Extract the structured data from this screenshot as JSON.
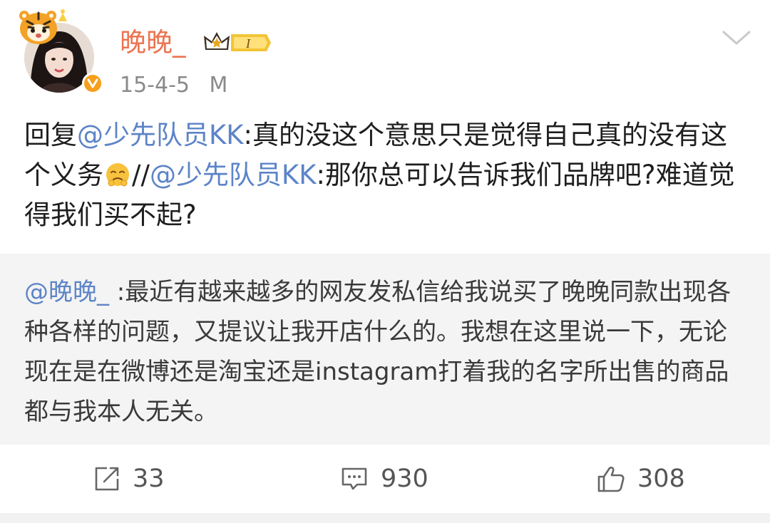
{
  "post": {
    "username": "晚晚_",
    "vip_level": "I",
    "date": "15-4-5",
    "source": "M",
    "content": {
      "prefix": "回复",
      "mention_1": "@少先队员KK",
      "text_1": ":真的没这个意思只是觉得自己真的没有这个义务",
      "emoji": "wronged-face-emoji",
      "separator": "//",
      "mention_2": "@少先队员KK",
      "text_2": ":那你总可以告诉我们品牌吧?难道觉得我们买不起?"
    },
    "retweet": {
      "mention": "@晚晚_",
      "text": " :最近有越来越多的网友发私信给我说买了晚晚同款出现各种各样的问题，又提议让我开店什么的。我想在这里说一下，无论现在是在微博还是淘宝还是instagram打着我的名字所出售的商品都与我本人无关。"
    },
    "actions": {
      "repost_count": "33",
      "comment_count": "930",
      "like_count": "308"
    },
    "colors": {
      "username": "#eb7350",
      "mention": "#5d84c7",
      "verified": "#f59f1a",
      "retweet_bg": "#f4f4f4"
    },
    "icons": {
      "more": "chevron-down-icon",
      "repost": "repost-icon",
      "comment": "comment-icon",
      "like": "thumbs-up-icon",
      "verified": "verified-v-icon",
      "vip": "vip-crown-badge"
    }
  }
}
